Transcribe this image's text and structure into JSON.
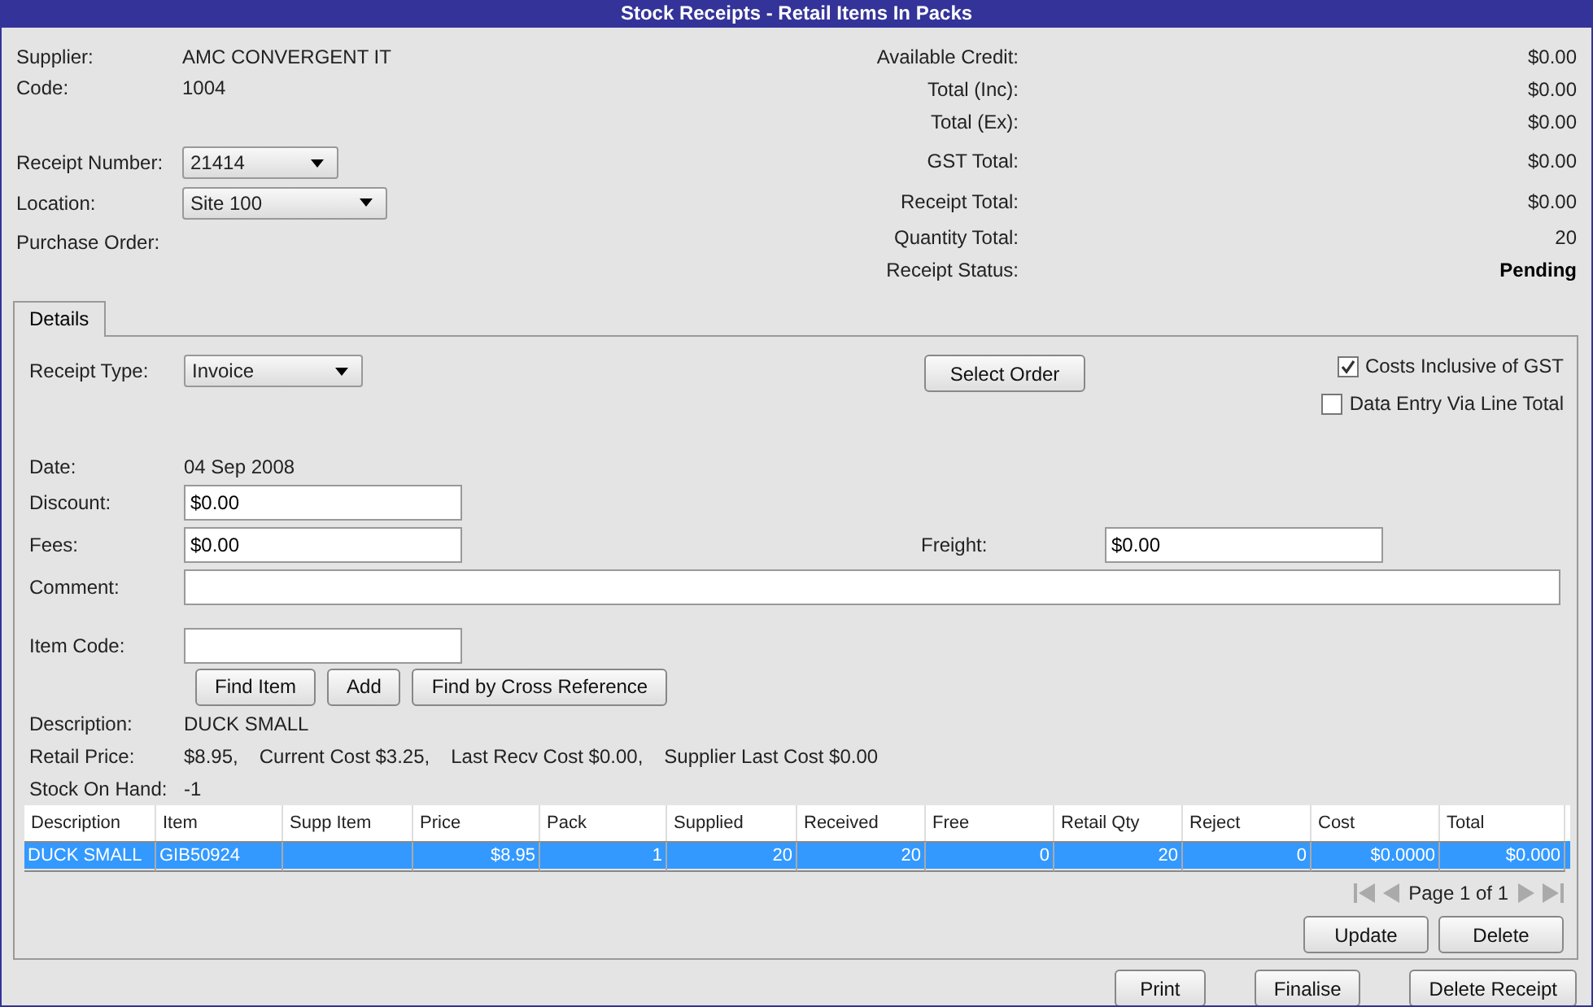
{
  "window": {
    "title": "Stock Receipts  - Retail Items In Packs"
  },
  "header_left": [
    {
      "kind": "text",
      "label": "Supplier:",
      "value": "AMC CONVERGENT IT"
    },
    {
      "kind": "text",
      "label": "Code:",
      "value": "1004"
    },
    {
      "kind": "dropdown",
      "label": "Receipt Number:",
      "value": "21414"
    },
    {
      "kind": "dropdown",
      "label": "Location:",
      "value": "Site 100"
    },
    {
      "kind": "text",
      "label": "Purchase Order:"
    }
  ],
  "header_right": [
    {
      "label": "Available Credit:",
      "value": "$0.00",
      "bold": false
    },
    {
      "label": "Total (Inc):",
      "value": "$0.00",
      "bold": false
    },
    {
      "label": "Total (Ex):",
      "value": "$0.00",
      "bold": false
    },
    {
      "label": "GST Total:",
      "value": "$0.00",
      "bold": false
    },
    {
      "label": "Receipt Total:",
      "value": "$0.00",
      "bold": false
    },
    {
      "label": "Quantity Total:",
      "value": "20",
      "bold": false
    },
    {
      "label": "Receipt Status:",
      "value": "Pending",
      "bold": true
    }
  ],
  "tabs": [
    {
      "label": "Details",
      "selected": true
    }
  ],
  "details": {
    "receipt_type": {
      "label": "Receipt Type:",
      "value": "Invoice"
    },
    "select_order_button": "Select Order",
    "checkboxes": [
      {
        "label": "Costs Inclusive of GST",
        "checked": true
      },
      {
        "label": "Data Entry Via Line Total",
        "checked": false
      }
    ],
    "date": {
      "label": "Date:",
      "value": "04 Sep 2008"
    },
    "discount": {
      "label": "Discount:",
      "value": "$0.00"
    },
    "fees": {
      "label": "Fees:",
      "value": "$0.00"
    },
    "freight": {
      "label": "Freight:",
      "value": "$0.00"
    },
    "comment": {
      "label": "Comment:"
    },
    "item_code": {
      "label": "Item Code:"
    },
    "item_buttons": [
      "Find Item",
      "Add",
      "Find by Cross Reference"
    ],
    "description": {
      "label": "Description:",
      "value": "DUCK SMALL"
    },
    "retail_price": {
      "label": "Retail Price:",
      "parts": [
        "$8.95,",
        "Current Cost $3.25,",
        "Last Recv Cost $0.00,",
        "Supplier Last Cost $0.00"
      ]
    },
    "stock_on_hand": {
      "label": "Stock On Hand:",
      "value": "-1"
    }
  },
  "table": {
    "columns": [
      "Description",
      "Item",
      "Supp Item",
      "Price",
      "Pack",
      "Supplied",
      "Received",
      "Free",
      "Retail Qty",
      "Reject",
      "Cost",
      "Total"
    ],
    "rows": [
      {
        "selected": true,
        "cells": [
          "DUCK SMALL",
          "GIB50924",
          "",
          "$8.95",
          "1",
          "20",
          "20",
          "0",
          "20",
          "0",
          "$0.0000",
          "$0.000"
        ]
      }
    ]
  },
  "pagination": {
    "text": "Page 1 of 1"
  },
  "table_buttons": [
    "Update",
    "Delete"
  ],
  "footer_buttons": [
    "Print",
    "Finalise",
    "Delete Receipt"
  ]
}
